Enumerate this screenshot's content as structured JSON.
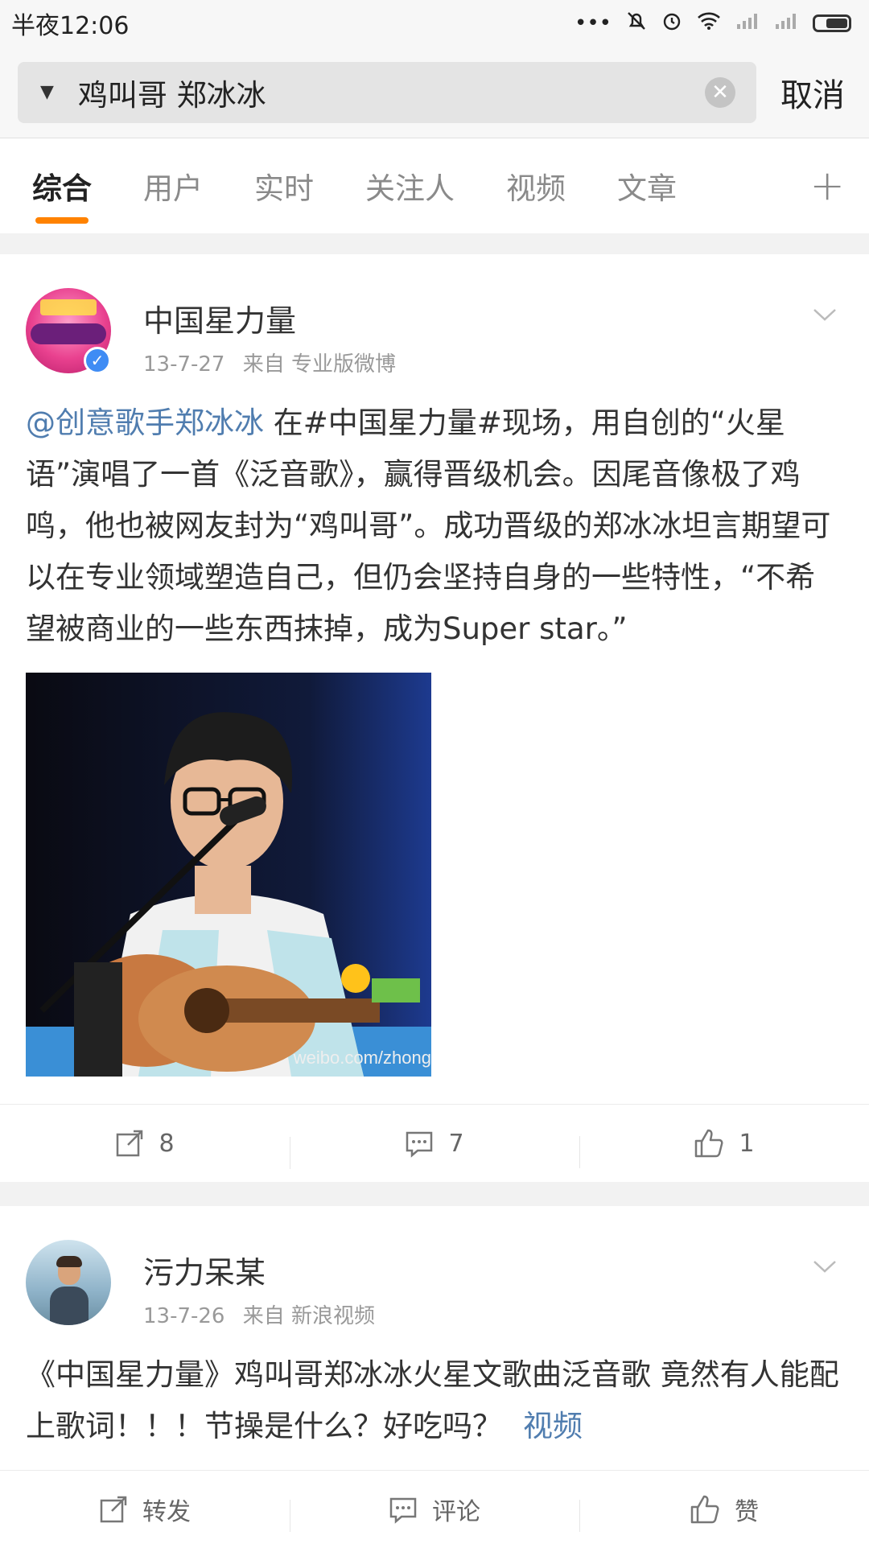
{
  "status_bar": {
    "time": "半夜12:06"
  },
  "search": {
    "query": "鸡叫哥 郑冰冰",
    "cancel_label": "取消"
  },
  "tabs": [
    {
      "label": "综合",
      "active": true
    },
    {
      "label": "用户"
    },
    {
      "label": "实时"
    },
    {
      "label": "关注人"
    },
    {
      "label": "视频"
    },
    {
      "label": "文章"
    }
  ],
  "posts": [
    {
      "user_name": "中国星力量",
      "date": "13-7-27",
      "source": "来自 专业版微博",
      "mention": "@创意歌手郑冰冰",
      "text": " 在#中国星力量#现场，用自创的“火星语”演唱了一首《泛音歌》，赢得晋级机会。因尾音像极了鸡鸣，他也被网友封为“鸡叫哥”。成功晋级的郑冰冰坦言期望可以在专业领域塑造自己，但仍会坚持自身的一些特性，“不希望被商业的一些东西抹掉，成为Super star。”",
      "image_watermark": "weibo.com/zhong",
      "repost_count": "8",
      "comment_count": "7",
      "like_count": "1"
    },
    {
      "user_name": "污力呆某",
      "date": "13-7-26",
      "source": "来自 新浪视频",
      "text": "《中国星力量》鸡叫哥郑冰冰火星文歌曲泛音歌 竟然有人能配上歌词！！！节操是什么？好吃吗？",
      "video_link": "视频",
      "repost_label": "转发",
      "comment_label": "评论",
      "like_label": "赞"
    }
  ]
}
